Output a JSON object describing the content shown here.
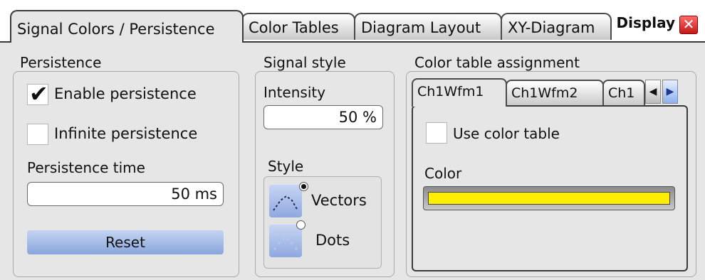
{
  "dialog": {
    "title": "Display",
    "close_symbol": "✕"
  },
  "tabs": [
    {
      "label": "Signal Colors / Persistence",
      "active": true
    },
    {
      "label": "Color Tables",
      "active": false
    },
    {
      "label": "Diagram Layout",
      "active": false
    },
    {
      "label": "XY-Diagram",
      "active": false
    }
  ],
  "persistence": {
    "title": "Persistence",
    "enable": {
      "label": "Enable persistence",
      "checked": true
    },
    "infinite": {
      "label": "Infinite persistence",
      "checked": false
    },
    "time_label": "Persistence time",
    "time_value": "50 ms",
    "reset_label": "Reset"
  },
  "signal_style": {
    "title": "Signal style",
    "intensity_label": "Intensity",
    "intensity_value": "50 %",
    "style_label": "Style",
    "options": [
      {
        "label": "Vectors",
        "selected": true
      },
      {
        "label": "Dots",
        "selected": false
      }
    ]
  },
  "color_table_assignment": {
    "title": "Color table assignment",
    "tabs": [
      "Ch1Wfm1",
      "Ch1Wfm2",
      "Ch1"
    ],
    "active_tab": 0,
    "use_color_table": {
      "label": "Use color table",
      "checked": false
    },
    "color_label": "Color",
    "color_value": "#ffee00"
  },
  "colors": {
    "accent_blue": "#8ea8de",
    "yellow": "#ffee00"
  }
}
